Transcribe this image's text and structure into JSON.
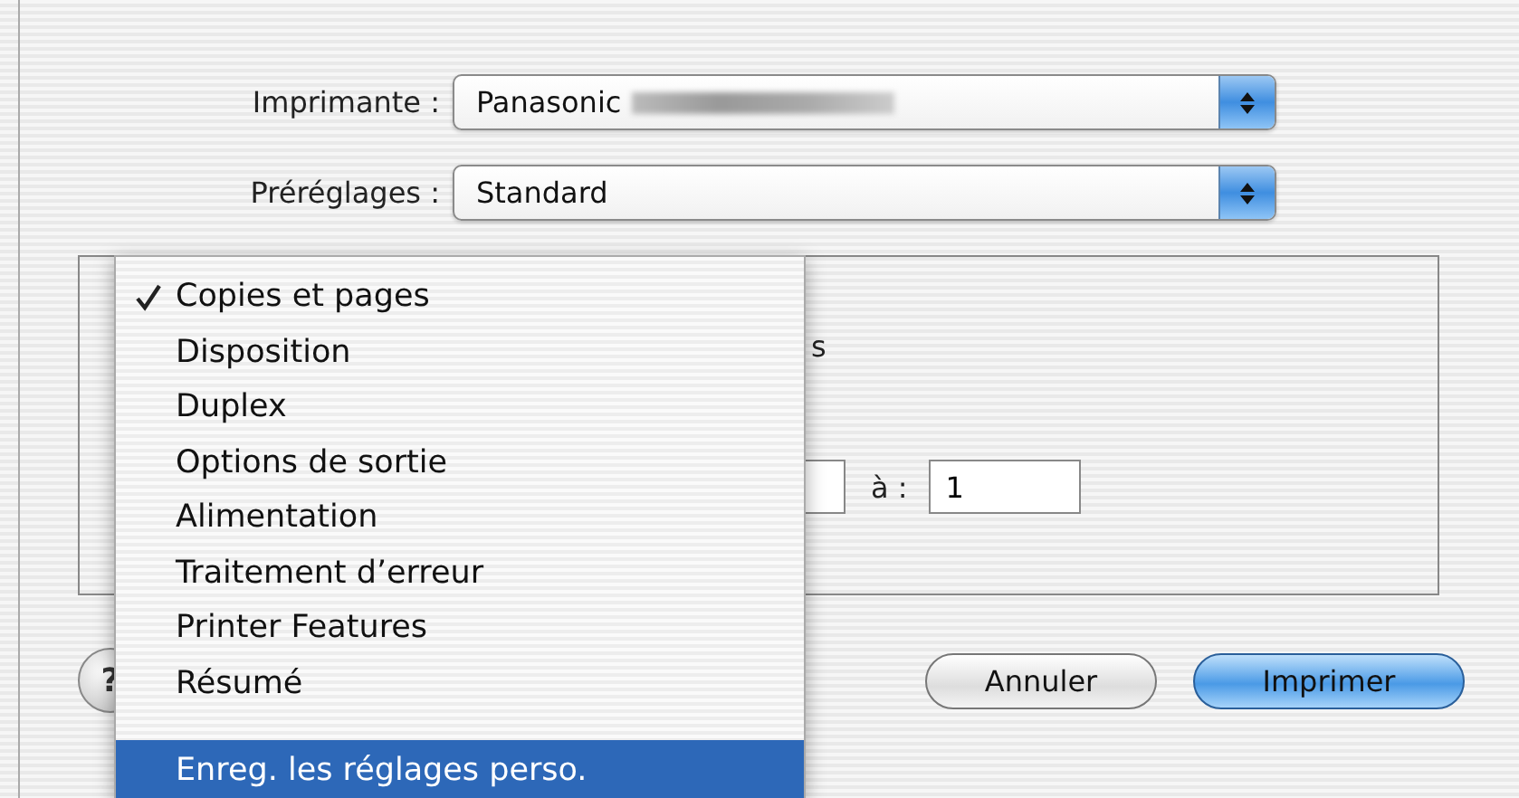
{
  "printer": {
    "label": "Imprimante :",
    "value": "Panasonic"
  },
  "presets": {
    "label": "Préréglages :",
    "value": "Standard"
  },
  "panel": {
    "column_1_tail": "s",
    "to_label": "à :",
    "to": "1"
  },
  "help": "?",
  "buttons": {
    "cancel": "Annuler",
    "print": "Imprimer"
  },
  "menu": {
    "items": [
      {
        "kind": "item",
        "label": "Copies et pages",
        "checked": true,
        "selected": false
      },
      {
        "kind": "item",
        "label": "Disposition",
        "checked": false,
        "selected": false
      },
      {
        "kind": "item",
        "label": "Duplex",
        "checked": false,
        "selected": false
      },
      {
        "kind": "item",
        "label": "Options de sortie",
        "checked": false,
        "selected": false
      },
      {
        "kind": "item",
        "label": "Alimentation",
        "checked": false,
        "selected": false
      },
      {
        "kind": "item",
        "label": "Traitement d’erreur",
        "checked": false,
        "selected": false
      },
      {
        "kind": "item",
        "label": "Printer Features",
        "checked": false,
        "selected": false
      },
      {
        "kind": "item",
        "label": "Résumé",
        "checked": false,
        "selected": false
      },
      {
        "kind": "separator"
      },
      {
        "kind": "item",
        "label": "Enreg. les réglages perso.",
        "checked": false,
        "selected": true
      }
    ]
  }
}
